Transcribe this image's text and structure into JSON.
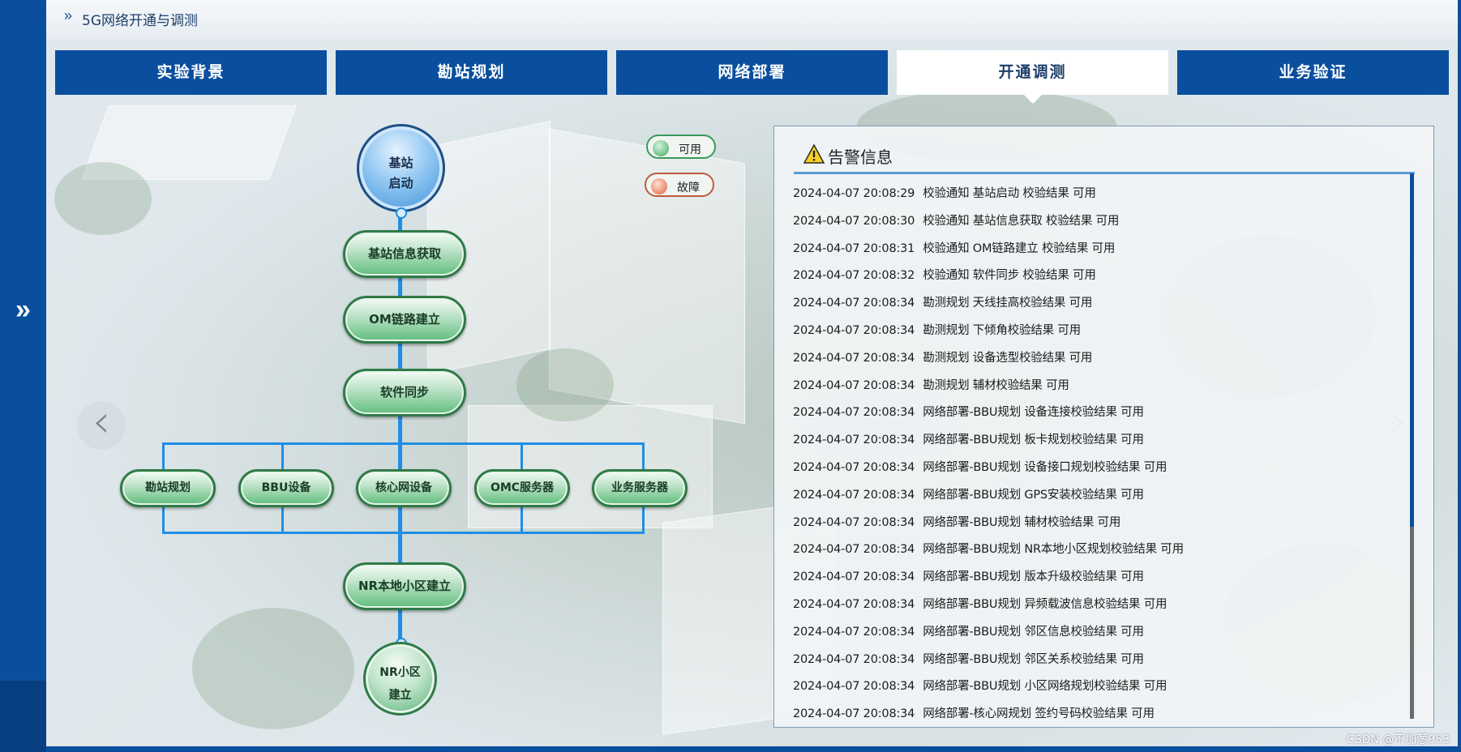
{
  "header": {
    "title": "5G网络开通与调测"
  },
  "tabs": [
    {
      "label": "实验背景",
      "active": false
    },
    {
      "label": "勘站规划",
      "active": false
    },
    {
      "label": "网络部署",
      "active": false
    },
    {
      "label": "开通调测",
      "active": true
    },
    {
      "label": "业务验证",
      "active": false
    }
  ],
  "flow": {
    "start": "基站\n启动",
    "start_line1": "基站",
    "start_line2": "启动",
    "steps": [
      "基站信息获取",
      "OM链路建立",
      "软件同步"
    ],
    "branches": [
      "勘站规划",
      "BBU设备",
      "核心网设备",
      "OMC服务器",
      "业务服务器"
    ],
    "after": "NR本地小区建立",
    "end_line1": "NR小区",
    "end_line2": "建立"
  },
  "legend": {
    "ok": "可用",
    "fault": "故障"
  },
  "colors": {
    "brand_blue": "#0a4f9e",
    "ok_green": "#3aa85f",
    "fault_red": "#e0603a"
  },
  "alarm": {
    "title": "告警信息",
    "items": [
      {
        "time": "2024-04-07 20:08:29",
        "msg": "校验通知 基站启动 校验结果 可用"
      },
      {
        "time": "2024-04-07 20:08:30",
        "msg": "校验通知 基站信息获取 校验结果 可用"
      },
      {
        "time": "2024-04-07 20:08:31",
        "msg": "校验通知 OM链路建立 校验结果 可用"
      },
      {
        "time": "2024-04-07 20:08:32",
        "msg": "校验通知 软件同步 校验结果 可用"
      },
      {
        "time": "2024-04-07 20:08:34",
        "msg": "勘测规划 天线挂高校验结果 可用"
      },
      {
        "time": "2024-04-07 20:08:34",
        "msg": "勘测规划 下倾角校验结果 可用"
      },
      {
        "time": "2024-04-07 20:08:34",
        "msg": "勘测规划 设备选型校验结果 可用"
      },
      {
        "time": "2024-04-07 20:08:34",
        "msg": "勘测规划 辅材校验结果 可用"
      },
      {
        "time": "2024-04-07 20:08:34",
        "msg": "网络部署-BBU规划 设备连接校验结果 可用"
      },
      {
        "time": "2024-04-07 20:08:34",
        "msg": "网络部署-BBU规划 板卡规划校验结果 可用"
      },
      {
        "time": "2024-04-07 20:08:34",
        "msg": "网络部署-BBU规划 设备接口规划校验结果 可用"
      },
      {
        "time": "2024-04-07 20:08:34",
        "msg": "网络部署-BBU规划 GPS安装校验结果 可用"
      },
      {
        "time": "2024-04-07 20:08:34",
        "msg": "网络部署-BBU规划 辅材校验结果 可用"
      },
      {
        "time": "2024-04-07 20:08:34",
        "msg": "网络部署-BBU规划 NR本地小区规划校验结果 可用"
      },
      {
        "time": "2024-04-07 20:08:34",
        "msg": "网络部署-BBU规划 版本升级校验结果 可用"
      },
      {
        "time": "2024-04-07 20:08:34",
        "msg": "网络部署-BBU规划 异频载波信息校验结果 可用"
      },
      {
        "time": "2024-04-07 20:08:34",
        "msg": "网络部署-BBU规划 邻区信息校验结果 可用"
      },
      {
        "time": "2024-04-07 20:08:34",
        "msg": "网络部署-BBU规划 邻区关系校验结果 可用"
      },
      {
        "time": "2024-04-07 20:08:34",
        "msg": "网络部署-BBU规划 小区网络规划校验结果 可用"
      },
      {
        "time": "2024-04-07 20:08:34",
        "msg": "网络部署-核心网规划 签约号码校验结果 可用"
      }
    ]
  },
  "watermark": "CSDN @不加葱953",
  "icons": {
    "sidebar_toggle": "double-chevron-right-icon",
    "warning": "warning-triangle-icon",
    "prev": "chevron-left-icon",
    "next": "chevron-right-icon"
  }
}
